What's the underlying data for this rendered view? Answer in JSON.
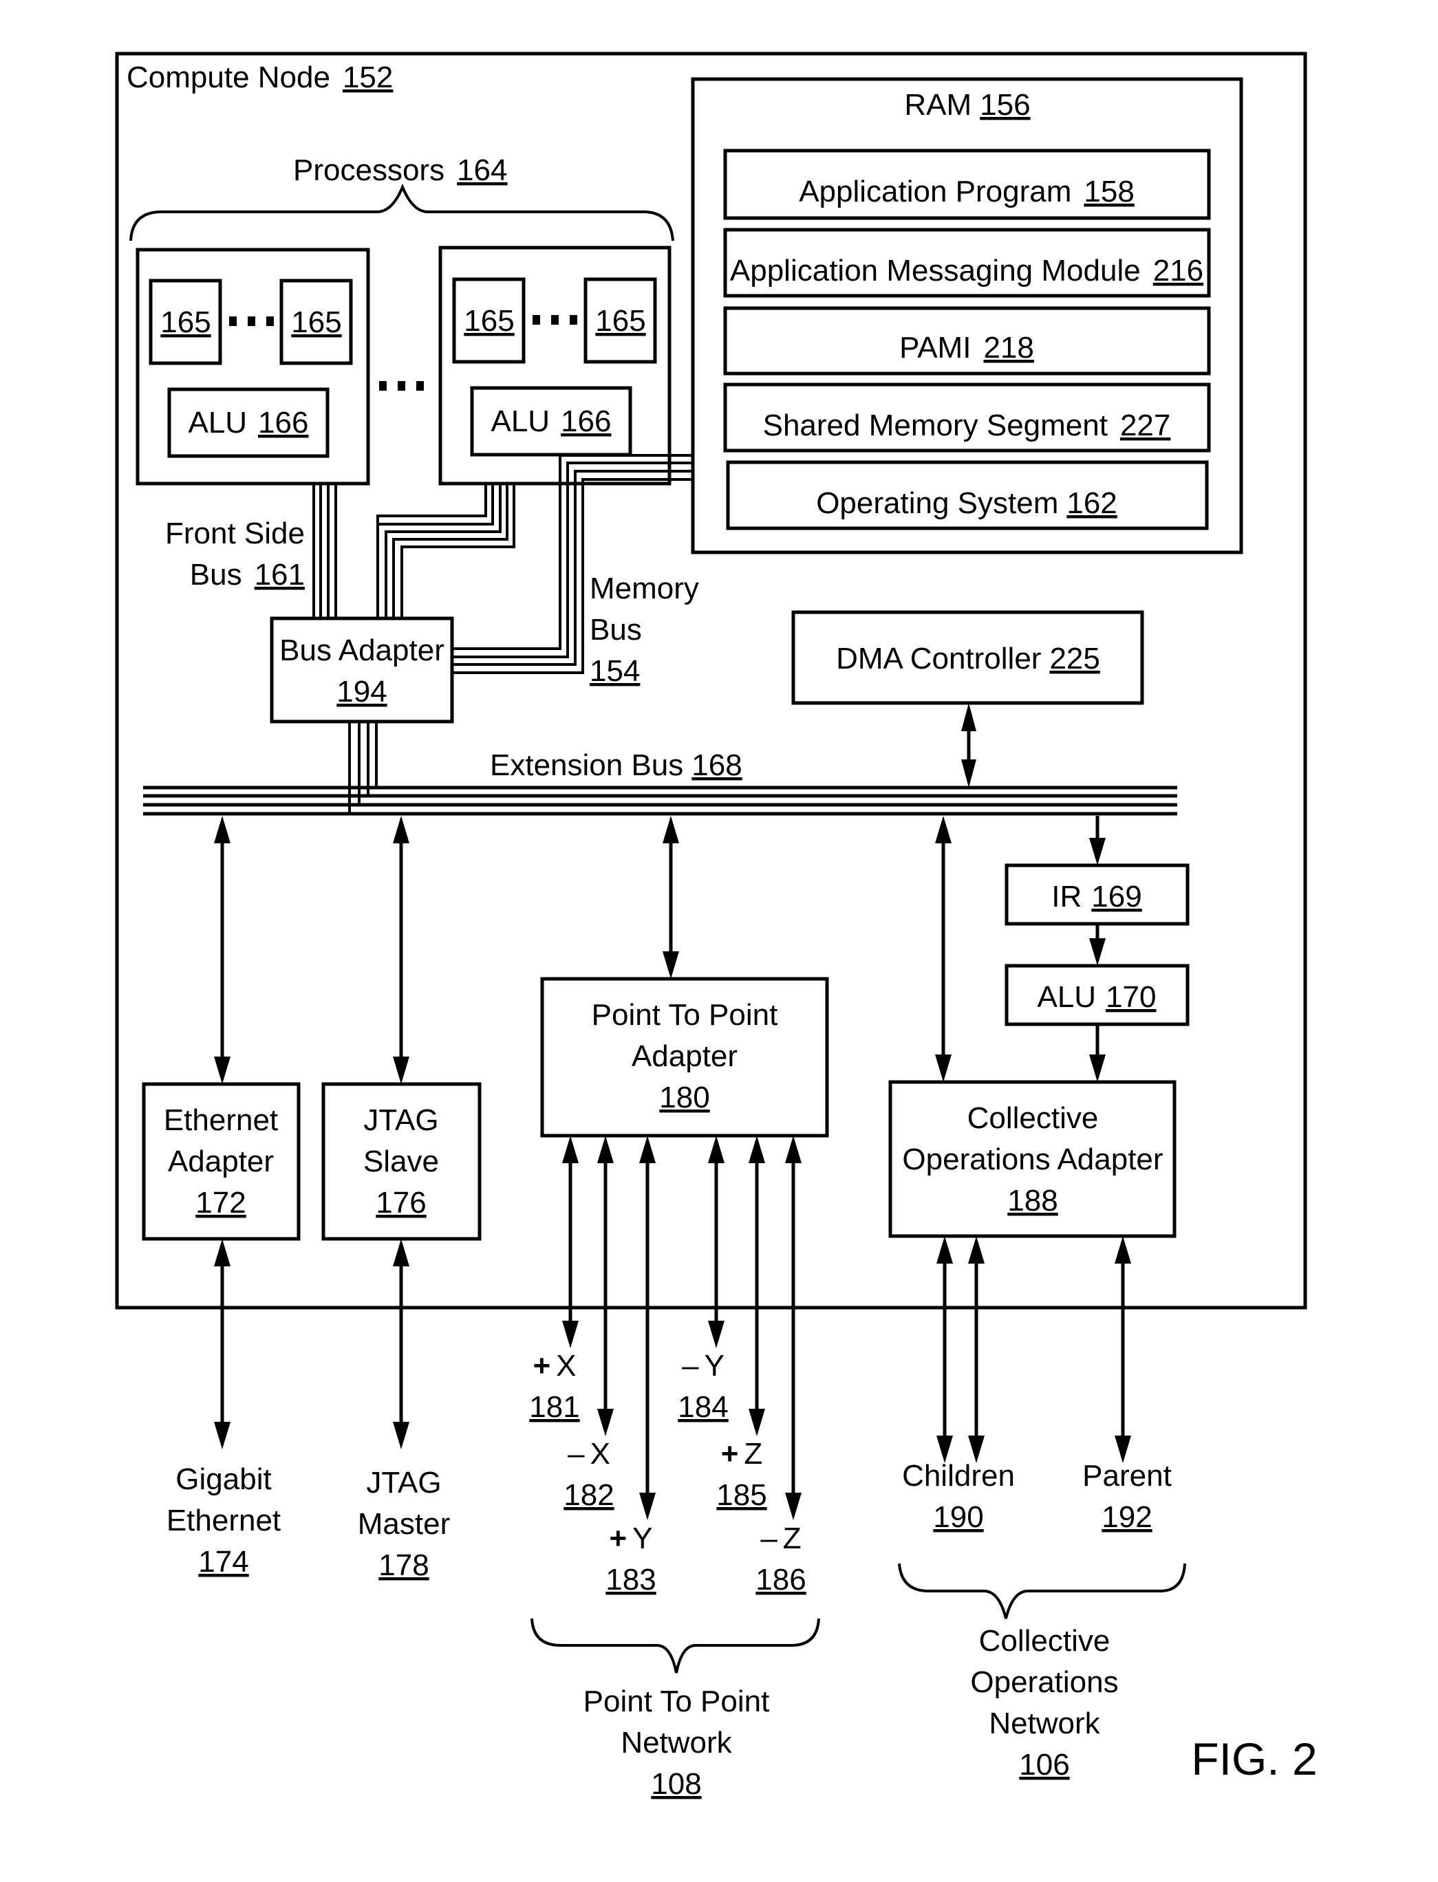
{
  "figure": {
    "label": "FIG. 2",
    "compute_node": {
      "name": "Compute Node",
      "ref": "152"
    },
    "processors": {
      "name": "Processors",
      "ref": "164",
      "core_ref": "165",
      "alu": {
        "name": "ALU",
        "ref": "166"
      },
      "ellipsis": "▪ ▪ ▪"
    },
    "ram": {
      "name": "RAM",
      "ref": "156",
      "items": [
        {
          "name": "Application Program",
          "ref": "158"
        },
        {
          "name": "Application Messaging Module",
          "ref": "216"
        },
        {
          "name": "PAMI",
          "ref": "218"
        },
        {
          "name": "Shared Memory Segment",
          "ref": "227"
        },
        {
          "name": "Operating System",
          "ref": "162"
        }
      ]
    },
    "front_side_bus": {
      "line1": "Front Side",
      "line2": "Bus",
      "ref": "161"
    },
    "memory_bus": {
      "line1": "Memory",
      "line2": "Bus",
      "ref": "154"
    },
    "bus_adapter": {
      "name": "Bus Adapter",
      "ref": "194"
    },
    "dma_controller": {
      "name": "DMA Controller",
      "ref": "225"
    },
    "extension_bus": {
      "name": "Extension Bus",
      "ref": "168"
    },
    "ir": {
      "name": "IR",
      "ref": "169"
    },
    "alu2": {
      "name": "ALU",
      "ref": "170"
    },
    "ethernet_adapter": {
      "line1": "Ethernet",
      "line2": "Adapter",
      "ref": "172"
    },
    "jtag_slave": {
      "line1": "JTAG",
      "line2": "Slave",
      "ref": "176"
    },
    "p2p_adapter": {
      "line1": "Point To Point",
      "line2": "Adapter",
      "ref": "180"
    },
    "collective_adapter": {
      "line1": "Collective",
      "line2": "Operations Adapter",
      "ref": "188"
    },
    "gigabit_ethernet": {
      "line1": "Gigabit",
      "line2": "Ethernet",
      "ref": "174"
    },
    "jtag_master": {
      "line1": "JTAG",
      "line2": "Master",
      "ref": "178"
    },
    "p2p_links": [
      {
        "sign": "+",
        "axis": "X",
        "ref": "181"
      },
      {
        "sign": "–",
        "axis": "X",
        "ref": "182"
      },
      {
        "sign": "+",
        "axis": "Y",
        "ref": "183"
      },
      {
        "sign": "–",
        "axis": "Y",
        "ref": "184"
      },
      {
        "sign": "+",
        "axis": "Z",
        "ref": "185"
      },
      {
        "sign": "–",
        "axis": "Z",
        "ref": "186"
      }
    ],
    "children": {
      "name": "Children",
      "ref": "190"
    },
    "parent": {
      "name": "Parent",
      "ref": "192"
    },
    "p2p_network": {
      "line1": "Point To Point",
      "line2": "Network",
      "ref": "108"
    },
    "collective_network": {
      "line1": "Collective",
      "line2": "Operations",
      "line3": "Network",
      "ref": "106"
    }
  }
}
